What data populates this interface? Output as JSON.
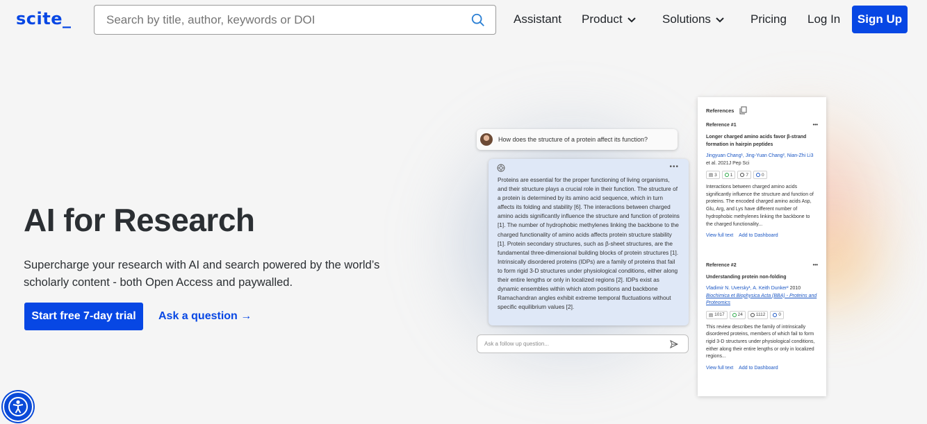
{
  "header": {
    "logo": "scite_",
    "search_placeholder": "Search by title, author, keywords or DOI",
    "nav": {
      "assistant": "Assistant",
      "product": "Product",
      "solutions": "Solutions",
      "pricing": "Pricing",
      "login": "Log In",
      "signup": "Sign Up"
    }
  },
  "hero": {
    "title": "AI for Research",
    "subtitle": "Supercharge your research with AI and search powered by the world’s scholarly content - both Open Access and paywalled.",
    "cta": "Start free 7-day trial",
    "ask": "Ask a question →"
  },
  "chat": {
    "question": "How does the structure of a protein affect its function?",
    "answer": "Proteins are essential for the proper functioning of living organisms, and their structure plays a crucial role in their function. The structure of a protein is determined by its amino acid sequence, which in turn affects its folding and stability [6]. The interactions between charged amino acids significantly influence the structure and function of proteins [1]. The number of hydrophobic methylenes linking the backbone to the charged functionality of amino acids affects protein structure stability [1]. Protein secondary structures, such as β-sheet structures, are the fundamental three-dimensional building blocks of protein structures [1]. Intrinsically disordered proteins (IDPs) are a family of proteins that fail to form rigid 3-D structures under physiological conditions, either along their entire lengths or only in localized regions [2]. IDPs exist as dynamic ensembles within which atom positions and backbone Ramachandran angles exhibit extreme temporal fluctuations without specific equilibrium values [2].",
    "more": "•••",
    "followup_placeholder": "Ask a follow up question..."
  },
  "references": {
    "title": "References",
    "items": [
      {
        "label": "Reference #1",
        "more": "•••",
        "title": "Longer charged amino acids favor β-strand formation in hairpin peptides",
        "authors": "Jingyuan Chang¹, Jing-Yuan Chang², Nian-Zhi Li3",
        "meta": " et al. 2021J Pep Sci",
        "badges": [
          "3",
          "1",
          "7",
          "0"
        ],
        "abstract": "Interactions between charged amino acids significantly influence the structure and function of proteins. The encoded charged amino acids Asp, Glu, Arg, and Lys have different number of hydrophobic methylenes linking the backbone to the charged functionality...",
        "link1": "View full text",
        "link2": "Add to Dashboard"
      },
      {
        "label": "Reference #2",
        "more": "•••",
        "title": "Understanding protein non-folding",
        "authors": "Vladimir N. Uversky¹, A. Keith Dunker²",
        "meta": " 2010 ",
        "journal": "Biochimica et Biophysica Acta (BBA) - Proteins and Proteomics",
        "badges": [
          "1017",
          "24",
          "1112",
          "0"
        ],
        "abstract": "This review describes the family of intrinsically disordered proteins, members of which fail to form rigid 3-D structures under physiological conditions, either along their entire lengths or only in localized regions...",
        "link1": "View full text",
        "link2": "Add to Dashboard"
      }
    ]
  },
  "colors": {
    "brand": "#0747e4"
  }
}
